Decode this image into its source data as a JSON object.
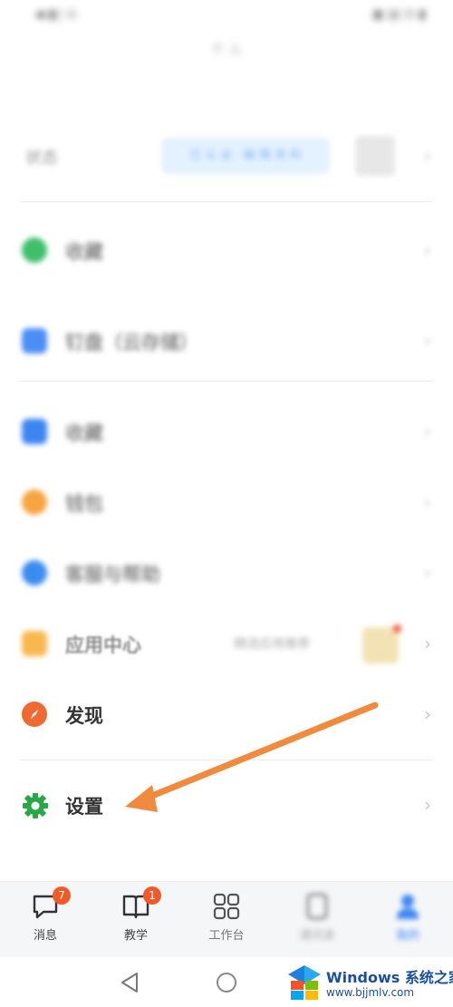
{
  "status_bar": {
    "left": "◀ ▮▯ ⊙",
    "right": "▣ ▤ ⊡ ▮"
  },
  "header": {
    "title": "个 人"
  },
  "profile": {
    "label": "状态",
    "pill": "已 认 证 · 编 辑 资 料"
  },
  "menu": [
    {
      "id": "favorites",
      "label": "收藏",
      "icon": "green-circle-icon",
      "color": "#3fbf6a"
    },
    {
      "id": "cloud-disk",
      "label": "钉盘（云存储）",
      "icon": "blue-folder-icon",
      "color": "#4d8ef5"
    },
    {
      "id": "collection",
      "label": "收藏",
      "icon": "blue-folder-icon",
      "color": "#3d86f2"
    },
    {
      "id": "wallet",
      "label": "钱包",
      "icon": "orange-flame-icon",
      "color": "#f7a440"
    },
    {
      "id": "help",
      "label": "客服与帮助",
      "icon": "blue-shield-icon",
      "color": "#3b8cf0"
    },
    {
      "id": "app-center",
      "label": "应用中心",
      "icon": "orange-bag-icon",
      "color": "#f8b84e",
      "extra": "精选应用推荐"
    },
    {
      "id": "discover",
      "label": "发现",
      "icon": "compass-icon",
      "color": "#ef6a30"
    },
    {
      "id": "settings",
      "label": "设置",
      "icon": "gear-icon",
      "color": "#28a745"
    }
  ],
  "tabs": [
    {
      "id": "messages",
      "label": "消息",
      "badge": "7",
      "icon": "chat-bubble-icon"
    },
    {
      "id": "teaching",
      "label": "教学",
      "badge": "1",
      "icon": "book-icon"
    },
    {
      "id": "workbench",
      "label": "工作台",
      "badge": "",
      "icon": "grid-icon"
    },
    {
      "id": "contacts",
      "label": "通讯录",
      "badge": "",
      "icon": "contacts-icon"
    },
    {
      "id": "me",
      "label": "我的",
      "badge": "",
      "icon": "person-icon",
      "active": true
    }
  ],
  "system_nav": {
    "back": "◁",
    "home": "○"
  },
  "watermark": {
    "brand": "Windows 系统之家",
    "url": "www.bjjmlv.com"
  },
  "colors": {
    "accent": "#3d86f2",
    "badge": "#f05a28",
    "arrow": "#f08a3c"
  }
}
